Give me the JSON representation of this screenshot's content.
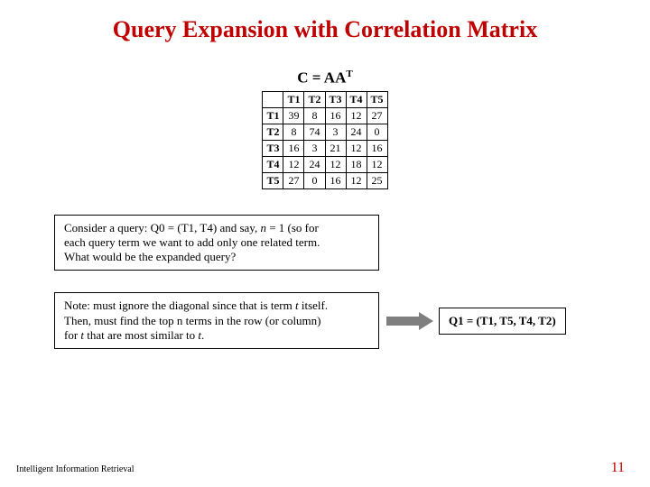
{
  "title": "Query Expansion with Correlation Matrix",
  "matrix_caption_prefix": "C = AA",
  "matrix_caption_sup": "T",
  "matrix": {
    "headers": [
      "T1",
      "T2",
      "T3",
      "T4",
      "T5"
    ],
    "rows": [
      {
        "label": "T1",
        "values": [
          39,
          8,
          16,
          12,
          27
        ]
      },
      {
        "label": "T2",
        "values": [
          8,
          74,
          3,
          24,
          0
        ]
      },
      {
        "label": "T3",
        "values": [
          16,
          3,
          21,
          12,
          16
        ]
      },
      {
        "label": "T4",
        "values": [
          12,
          24,
          12,
          18,
          12
        ]
      },
      {
        "label": "T5",
        "values": [
          27,
          0,
          16,
          12,
          25
        ]
      }
    ]
  },
  "box1": {
    "line1_a": "Consider a query: Q0 = (T1, T4) and say, ",
    "line1_n": "n",
    "line1_b": " = 1 (so for",
    "line2": "each query term we want to add only one related term.",
    "line3": "What would be the expanded query?"
  },
  "box2": {
    "line1_a": "Note: must ignore the diagonal since that is term ",
    "line1_t": "t",
    "line1_b": " itself.",
    "line2": "Then, must find the top n terms in the row (or column)",
    "line3_a": "for ",
    "line3_t1": "t",
    "line3_b": " that are most similar to ",
    "line3_t2": "t",
    "line3_c": "."
  },
  "answer": "Q1 = (T1, T5, T4, T2)",
  "footer_left": "Intelligent Information Retrieval",
  "footer_right": "11",
  "chart_data": {
    "type": "table",
    "title": "C = AA^T",
    "columns": [
      "T1",
      "T2",
      "T3",
      "T4",
      "T5"
    ],
    "rows": [
      "T1",
      "T2",
      "T3",
      "T4",
      "T5"
    ],
    "values": [
      [
        39,
        8,
        16,
        12,
        27
      ],
      [
        8,
        74,
        3,
        24,
        0
      ],
      [
        16,
        3,
        21,
        12,
        16
      ],
      [
        12,
        24,
        12,
        18,
        12
      ],
      [
        27,
        0,
        16,
        12,
        25
      ]
    ]
  }
}
